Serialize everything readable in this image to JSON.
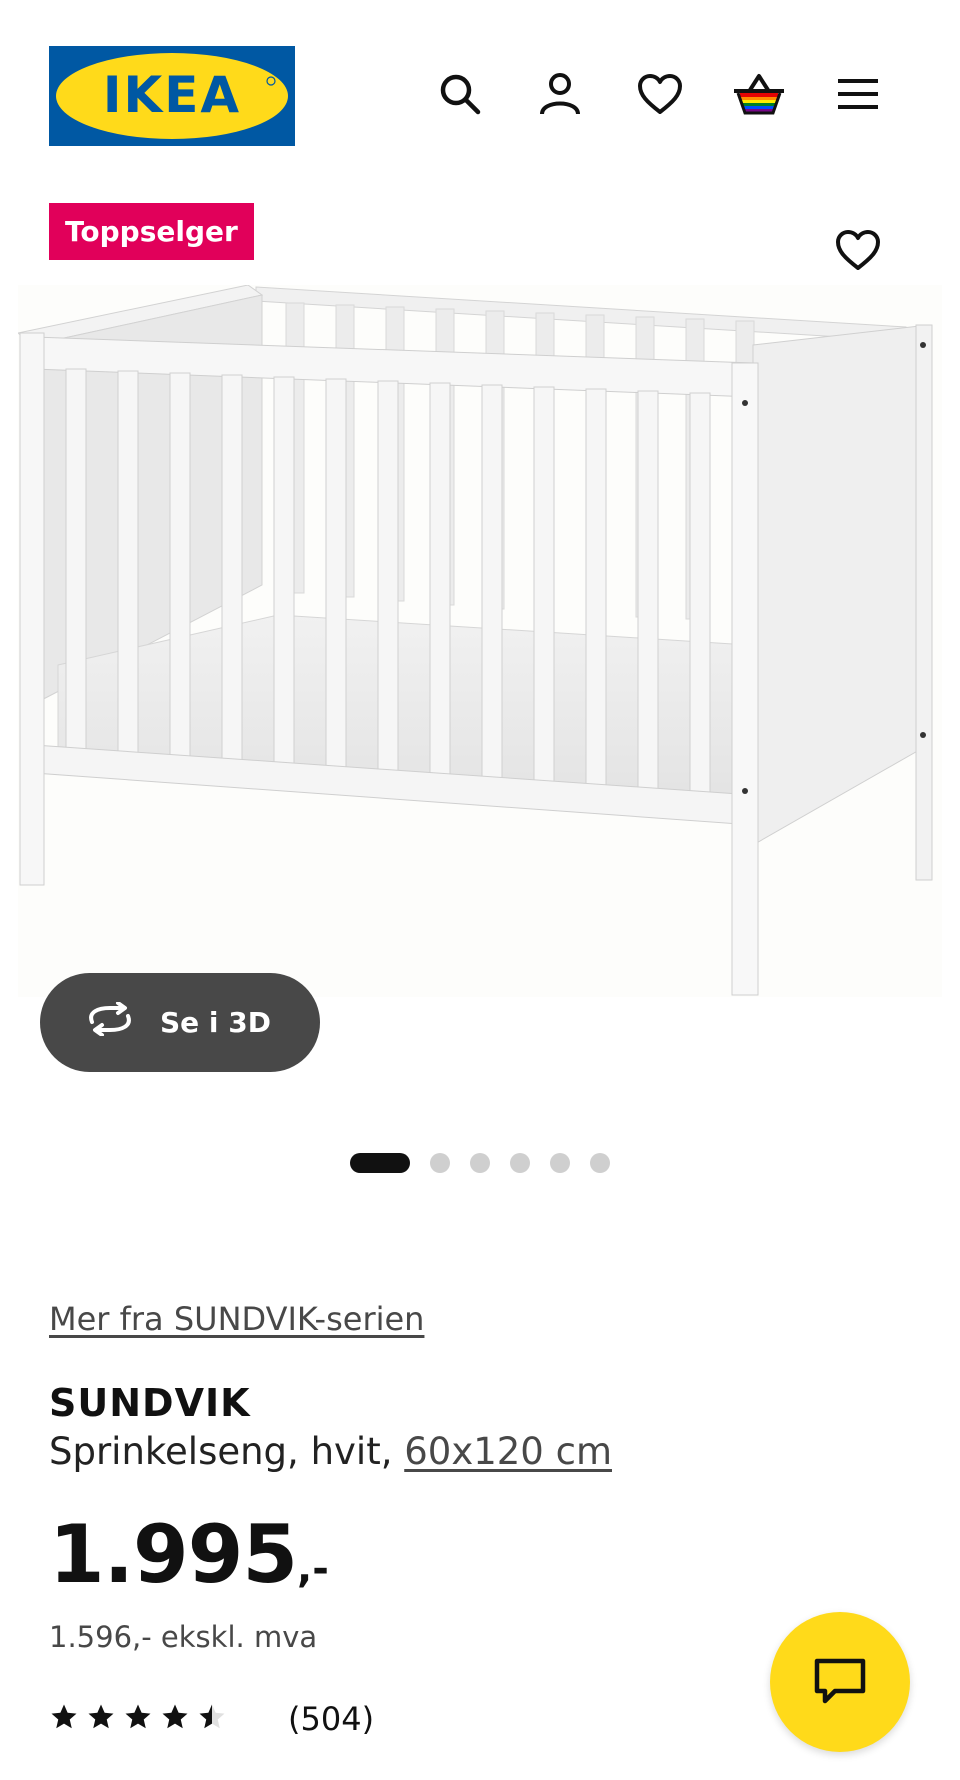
{
  "header": {
    "logo_text": "IKEA",
    "icons": [
      "search-icon",
      "account-icon",
      "favorites-heart-icon",
      "shopping-basket-icon",
      "menu-icon"
    ]
  },
  "gallery": {
    "badge": "Toppselger",
    "view_3d_label": "Se i 3D",
    "image_count": 6,
    "active_image": 1
  },
  "product": {
    "series_link": "Mer fra SUNDVIK-serien",
    "name": "SUNDVIK",
    "description": "Sprinkelseng, hvit, ",
    "size_link": "60x120 cm",
    "price_main": "1.995",
    "price_suffix": ",-",
    "price_ex_vat": "1.596,- ekskl. mva",
    "rating": 4.5,
    "rating_max": 5,
    "review_count": "(504)"
  },
  "colors": {
    "brand_blue": "#0058a3",
    "brand_yellow": "#ffda1a",
    "badge_red": "#e1005a"
  }
}
